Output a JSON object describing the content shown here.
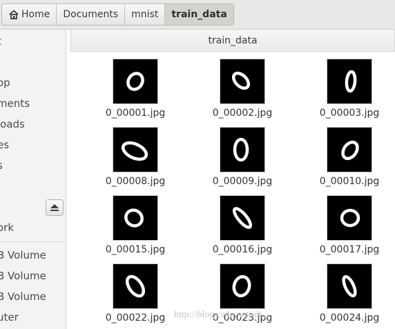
{
  "pathbar": {
    "crumbs": [
      {
        "label": "Home",
        "icon": "home-icon"
      },
      {
        "label": "Documents"
      },
      {
        "label": "mnist"
      },
      {
        "label": "train_data"
      }
    ]
  },
  "sidebar": {
    "items": [
      {
        "label": "t"
      },
      {
        "label": "op"
      },
      {
        "label": "ments"
      },
      {
        "label": "loads"
      },
      {
        "label": "es"
      },
      {
        "label": "s"
      },
      {
        "label": "ork"
      },
      {
        "label": "B Volume"
      },
      {
        "label": "B Volume"
      },
      {
        "label": "B Volume"
      },
      {
        "label": "uter"
      }
    ],
    "eject_icon": "eject-icon"
  },
  "main": {
    "title": "train_data",
    "files": [
      {
        "name": "0_00001.jpg"
      },
      {
        "name": "0_00002.jpg"
      },
      {
        "name": "0_00003.jpg"
      },
      {
        "name": "0_00008.jpg"
      },
      {
        "name": "0_00009.jpg"
      },
      {
        "name": "0_00010.jpg"
      },
      {
        "name": "0_00015.jpg"
      },
      {
        "name": "0_00016.jpg"
      },
      {
        "name": "0_00017.jpg"
      },
      {
        "name": "0_00022.jpg"
      },
      {
        "name": "0_00023.jpg"
      },
      {
        "name": "0_00024.jpg"
      }
    ]
  },
  "watermark": "http://blog.csdn.net/u0..."
}
